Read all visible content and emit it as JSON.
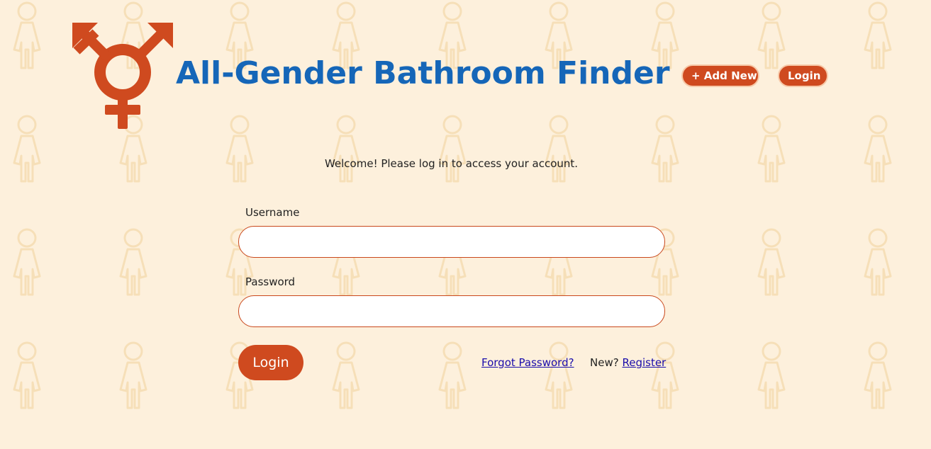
{
  "header": {
    "logo_icon": "transgender-symbol-icon",
    "title": "All-Gender Bathroom Finder",
    "nav": {
      "add_new_label": "+ Add New",
      "login_label": "Login"
    }
  },
  "background": {
    "pattern_icon": "person-outline-icon"
  },
  "login_form": {
    "welcome_text": "Welcome! Please log in to access your account.",
    "username_label": "Username",
    "username_value": "",
    "password_label": "Password",
    "password_value": "",
    "submit_label": "Login",
    "forgot_password_label": "Forgot Password?",
    "new_prefix": "New?",
    "register_label": "Register"
  },
  "colors": {
    "background": "#fdf0dc",
    "accent": "#cf4a1f",
    "title": "#1566b8",
    "link": "#1a0dab",
    "pattern": "#f6dcb2"
  }
}
